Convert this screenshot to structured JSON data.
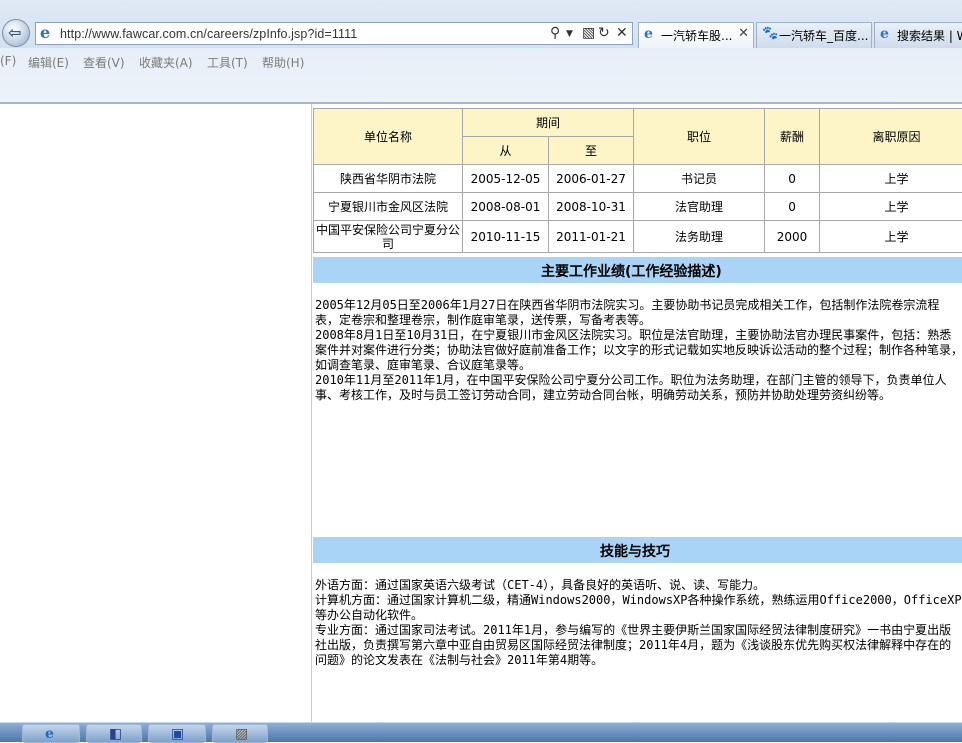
{
  "browser": {
    "url": "http://www.fawcar.com.cn/careers/zpInfo.jsp?id=1111",
    "tabs": [
      {
        "label": "一汽轿车股...",
        "active": true,
        "icon": "ie-icon"
      },
      {
        "label": "一汽轿车_百度...",
        "active": false,
        "icon": "baidu-paw-icon"
      },
      {
        "label": "搜索结果 | W",
        "active": false,
        "icon": "ie-icon"
      }
    ],
    "menu": [
      "(F)",
      "编辑(E)",
      "查看(V)",
      "收藏夹(A)",
      "工具(T)",
      "帮助(H)"
    ]
  },
  "work_table": {
    "headers": {
      "company": "单位名称",
      "period": "期间",
      "from": "从",
      "to": "至",
      "position": "职位",
      "salary": "薪酬",
      "reason": "离职原因"
    },
    "rows": [
      {
        "company": "陕西省华阴市法院",
        "from": "2005-12-05",
        "to": "2006-01-27",
        "position": "书记员",
        "salary": "0",
        "reason": "上学"
      },
      {
        "company": "宁夏银川市金风区法院",
        "from": "2008-08-01",
        "to": "2008-10-31",
        "position": "法官助理",
        "salary": "0",
        "reason": "上学"
      },
      {
        "company": "中国平安保险公司宁夏分公司",
        "from": "2010-11-15",
        "to": "2011-01-21",
        "position": "法务助理",
        "salary": "2000",
        "reason": "上学"
      }
    ]
  },
  "achievements": {
    "title": "主要工作业绩(工作经验描述)",
    "lines": [
      "2005年12月05日至2006年1月27日在陕西省华阴市法院实习。主要协助书记员完成相关工作，包括制作法院卷宗流程表，定卷宗和整理卷宗，制作庭审笔录，送传票，写备考表等。",
      "2008年8月1日至10月31日，在宁夏银川市金风区法院实习。职位是法官助理，主要协助法官办理民事案件，包括：熟悉案件并对案件进行分类；协助法官做好庭前准备工作；以文字的形式记载如实地反映诉讼活动的整个过程；制作各种笔录，如调查笔录、庭审笔录、合议庭笔录等。",
      "2010年11月至2011年1月，在中国平安保险公司宁夏分公司工作。职位为法务助理，在部门主管的领导下，负责单位人事、考核工作，及时与员工签订劳动合同，建立劳动合同台帐，明确劳动关系，预防并协助处理劳资纠纷等。"
    ]
  },
  "skills": {
    "title": "技能与技巧",
    "lines": [
      "外语方面：通过国家英语六级考试（CET-4），具备良好的英语听、说、读、写能力。",
      "计算机方面：通过国家计算机二级，精通Windows2000，WindowsXP各种操作系统，熟练运用Office2000，OfficeXP等办公自动化软件。",
      "专业方面：通过国家司法考试。2011年1月，参与编写的《世界主要伊斯兰国家国际经贸法律制度研究》一书由宁夏出版社出版，负责撰写第六章中亚自由贸易区国际经贸法律制度；2011年4月，题为《浅谈股东优先购买权法律解释中存在的问题》的论文发表在《法制与社会》2011年第4期等。"
    ]
  }
}
